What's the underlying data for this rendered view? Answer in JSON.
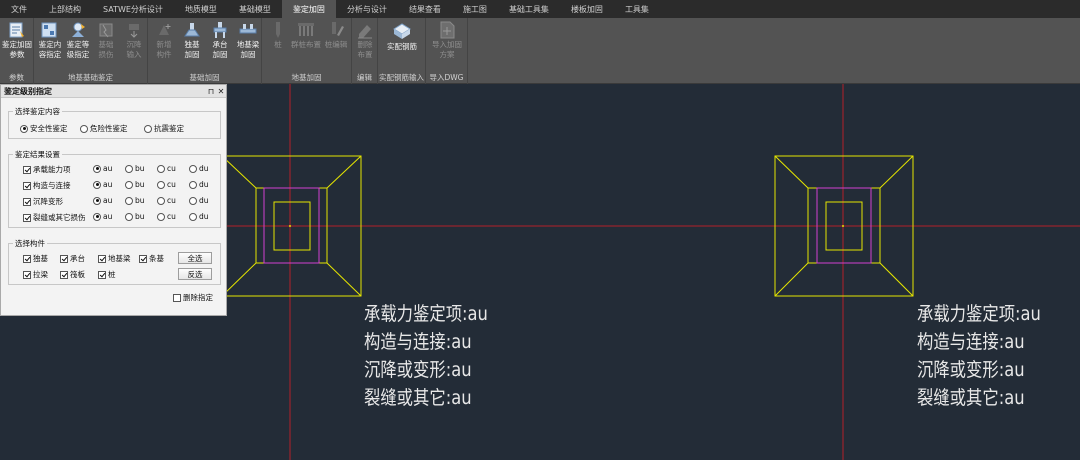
{
  "menu": [
    "文件",
    "上部结构",
    "SATWE分析设计",
    "地质模型",
    "基础模型",
    "鉴定加固",
    "分析与设计",
    "结果查看",
    "施工图",
    "基础工具集",
    "楼板加固",
    "工具集"
  ],
  "active_menu": "鉴定加固",
  "ribbon": {
    "groups": [
      {
        "label": "参数",
        "buttons": [
          {
            "label": "鉴定加固\n参数",
            "icon": "params-icon",
            "enabled": true
          }
        ]
      },
      {
        "label": "地基基础鉴定",
        "buttons": [
          {
            "label": "鉴定内\n容指定",
            "icon": "content-assign-icon",
            "enabled": true
          },
          {
            "label": "鉴定等\n级指定",
            "icon": "level-assign-icon",
            "enabled": true
          },
          {
            "label": "基础\n损伤",
            "icon": "damage-icon",
            "enabled": false
          },
          {
            "label": "沉降\n输入",
            "icon": "settlement-icon",
            "enabled": false
          }
        ]
      },
      {
        "label": "基础加固",
        "buttons": [
          {
            "label": "新增\n构件",
            "icon": "new-member-icon",
            "enabled": false
          },
          {
            "label": "独基\n加固",
            "icon": "isolated-footing-icon",
            "enabled": true
          },
          {
            "label": "承台\n加固",
            "icon": "pile-cap-icon",
            "enabled": true
          },
          {
            "label": "地基梁\n加固",
            "icon": "grade-beam-icon",
            "enabled": true
          }
        ]
      },
      {
        "label": "地基加固",
        "buttons": [
          {
            "label": "桩",
            "icon": "pile-icon",
            "enabled": false
          },
          {
            "label": "群桩布置",
            "icon": "pile-group-icon",
            "enabled": false
          },
          {
            "label": "桩编辑",
            "icon": "pile-edit-icon",
            "enabled": false
          }
        ]
      },
      {
        "label": "编辑",
        "buttons": [
          {
            "label": "删除\n布置",
            "icon": "delete-icon",
            "enabled": false
          }
        ]
      },
      {
        "label": "实配钢筋输入",
        "buttons": [
          {
            "label": "实配钢筋",
            "icon": "rebar-icon",
            "enabled": true
          }
        ]
      },
      {
        "label": "导入DWG",
        "buttons": [
          {
            "label": "导入加固\n方案",
            "icon": "import-dwg-icon",
            "enabled": false
          }
        ]
      }
    ]
  },
  "dialog": {
    "title": "鉴定级别指定",
    "pin": "⊓",
    "close": "✕",
    "section1": {
      "title": "选择鉴定内容",
      "options": [
        {
          "label": "安全性鉴定",
          "checked": true
        },
        {
          "label": "危险性鉴定",
          "checked": false
        },
        {
          "label": "抗震鉴定",
          "checked": false
        }
      ]
    },
    "section2": {
      "title": "鉴定结果设置",
      "rows": [
        {
          "label": "承载能力项",
          "checked": true
        },
        {
          "label": "构造与连接",
          "checked": true
        },
        {
          "label": "沉降变形",
          "checked": true
        },
        {
          "label": "裂缝或其它损伤",
          "checked": true
        }
      ],
      "grades": [
        "au",
        "bu",
        "cu",
        "du"
      ],
      "selected_grade": "au"
    },
    "section3": {
      "title": "选择构件",
      "items": [
        "独基",
        "承台",
        "地基梁",
        "条基",
        "拉梁",
        "筏板",
        "桩"
      ],
      "select_all": "全选",
      "invert": "反选"
    },
    "delete_assign": "删除指定"
  },
  "annotations": [
    {
      "lines": [
        "承载力鉴定项:au",
        "构造与连接:au",
        "沉降或变形:au",
        "裂缝或其它:au"
      ]
    },
    {
      "lines": [
        "承载力鉴定项:au",
        "构造与连接:au",
        "沉降或变形:au",
        "裂缝或其它:au"
      ]
    }
  ],
  "colors": {
    "canvas": "#232c37",
    "axis": "#b3202a",
    "outline": "#e6e600",
    "pedestal": "#d040d0"
  }
}
